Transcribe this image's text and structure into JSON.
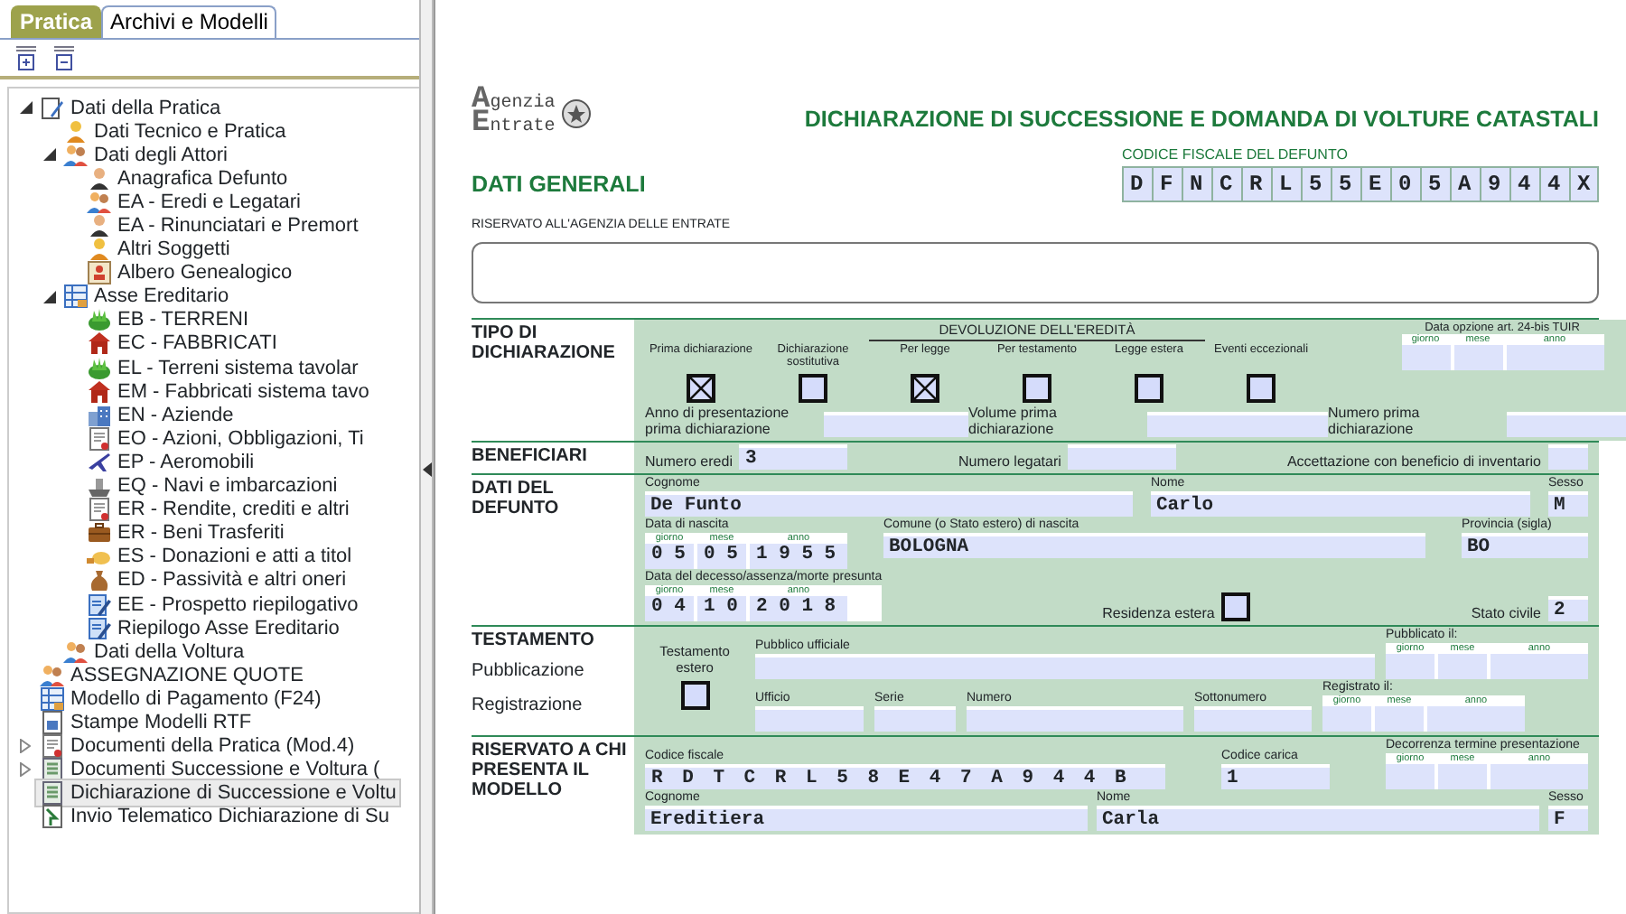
{
  "tabs": [
    {
      "label": "Pratica",
      "selected": true
    },
    {
      "label": "Archivi e Modelli",
      "selected": false
    }
  ],
  "tree": [
    {
      "label": "Dati della Pratica",
      "kind": "doc",
      "expanded": true,
      "selected": false,
      "children": [
        {
          "label": "Dati Tecnico e Pratica",
          "kind": "worker",
          "selected": false
        },
        {
          "label": "Dati degli Attori",
          "kind": "group",
          "expanded": true,
          "selected": false,
          "children": [
            {
              "label": "Anagrafica Defunto",
              "kind": "person",
              "selected": false
            },
            {
              "label": "EA - Eredi e Legatari",
              "kind": "group",
              "selected": false
            },
            {
              "label": "EA - Rinunciatari e Premort",
              "kind": "person",
              "selected": false
            },
            {
              "label": "Altri Soggetti",
              "kind": "worker",
              "selected": false
            },
            {
              "label": "Albero Genealogico",
              "kind": "chart",
              "selected": false
            }
          ]
        },
        {
          "label": "Asse Ereditario",
          "kind": "table",
          "expanded": true,
          "selected": false,
          "children": [
            {
              "label": "EB - TERRENI",
              "kind": "plant",
              "selected": false
            },
            {
              "label": "EC - FABBRICATI",
              "kind": "house",
              "selected": false
            },
            {
              "label": "EL - Terreni sistema tavolar",
              "kind": "plant",
              "selected": false
            },
            {
              "label": "EM - Fabbricati sistema tavo",
              "kind": "house",
              "selected": false
            },
            {
              "label": "EN - Aziende",
              "kind": "building",
              "selected": false
            },
            {
              "label": "EO - Azioni, Obbligazioni, Ti",
              "kind": "paper",
              "selected": false
            },
            {
              "label": "EP - Aeromobili",
              "kind": "plane",
              "selected": false
            },
            {
              "label": "EQ - Navi e imbarcazioni",
              "kind": "boat",
              "selected": false
            },
            {
              "label": "ER - Rendite, crediti e altri",
              "kind": "paper",
              "selected": false
            },
            {
              "label": "ER - Beni Trasferiti",
              "kind": "case",
              "selected": false
            },
            {
              "label": "ES - Donazioni e atti a titol",
              "kind": "hand",
              "selected": false
            },
            {
              "label": "ED - Passività e altri oneri",
              "kind": "bag",
              "selected": false
            },
            {
              "label": "EE - Prospetto riepilogativo",
              "kind": "edit",
              "selected": false
            },
            {
              "label": "Riepilogo Asse Ereditario",
              "kind": "edit",
              "selected": false
            }
          ]
        },
        {
          "label": "Dati della Voltura",
          "kind": "group",
          "selected": false
        }
      ]
    },
    {
      "label": "ASSEGNAZIONE QUOTE",
      "kind": "group",
      "selected": false
    },
    {
      "label": "Modello di Pagamento (F24)",
      "kind": "table",
      "selected": false
    },
    {
      "label": "Stampe Modelli RTF",
      "kind": "print",
      "selected": false
    },
    {
      "label": "Documenti della Pratica (Mod.4)",
      "kind": "paper",
      "expanded": false,
      "selected": false
    },
    {
      "label": "Documenti Successione e Voltura (",
      "kind": "sheet",
      "expanded": false,
      "selected": false
    },
    {
      "label": "Dichiarazione di Successione e Voltu",
      "kind": "sheet",
      "selected": true
    },
    {
      "label": "Invio Telematico Dichiarazione di Su",
      "kind": "send",
      "selected": false
    }
  ],
  "form": {
    "logo": [
      "Agenzia",
      "Entrate"
    ],
    "title": "DICHIARAZIONE DI SUCCESSIONE E DOMANDA DI VOLTURE CATASTALI",
    "codice_fiscale": {
      "label": "CODICE FISCALE DEL DEFUNTO",
      "value": "DFNCRL55E05A944X"
    },
    "heading": "DATI GENERALI",
    "reserved_label": "RISERVATO ALL'AGENZIA DELLE ENTRATE",
    "tipo": {
      "title": "TIPO DI DICHIARAZIONE",
      "group_label": "DEVOLUZIONE DELL'EREDITÀ",
      "checks": [
        {
          "label": "Prima dichiarazione",
          "checked": true
        },
        {
          "label": "Dichiarazione sostitutiva",
          "checked": false
        },
        {
          "label": "Per legge",
          "checked": true
        },
        {
          "label": "Per testamento",
          "checked": false
        },
        {
          "label": "Legge estera",
          "checked": false
        },
        {
          "label": "Eventi eccezionali",
          "checked": false
        }
      ],
      "option_date": {
        "label": "Data opzione art. 24-bis TUIR",
        "parts": [
          {
            "label": "giorno"
          },
          {
            "label": "mese"
          },
          {
            "label": "anno"
          }
        ]
      },
      "fields": [
        {
          "label": "Anno di presentazione prima dichiarazione"
        },
        {
          "label": "Volume prima dichiarazione"
        },
        {
          "label": "Numero prima dichiarazione"
        }
      ]
    },
    "beneficiari": {
      "title": "BENEFICIARI",
      "fields": [
        {
          "label": "Numero eredi",
          "value": "3"
        },
        {
          "label": "Numero legatari"
        },
        {
          "label": "Accettazione con beneficio di inventario"
        }
      ]
    },
    "defunto": {
      "title": "DATI DEL DEFUNTO",
      "cognome": {
        "label": "Cognome",
        "value": "De Funto"
      },
      "nome": {
        "label": "Nome",
        "value": "Carlo"
      },
      "sesso": {
        "label": "Sesso",
        "value": "M"
      },
      "nascita": {
        "label": "Data di nascita",
        "parts": [
          {
            "label": "giorno",
            "value": "05"
          },
          {
            "label": "mese",
            "value": "05"
          },
          {
            "label": "anno",
            "value": "1955"
          }
        ]
      },
      "comune": {
        "label": "Comune (o Stato estero) di nascita",
        "value": "BOLOGNA"
      },
      "provincia": {
        "label": "Provincia (sigla)",
        "value": "BO"
      },
      "decesso": {
        "label": "Data del decesso/assenza/morte presunta",
        "parts": [
          {
            "label": "giorno",
            "value": "04"
          },
          {
            "label": "mese",
            "value": "10"
          },
          {
            "label": "anno",
            "value": "2018"
          }
        ]
      },
      "residenza_estera": {
        "label": "Residenza estera",
        "checked": false
      },
      "stato_civile": {
        "label": "Stato civile",
        "value": "2"
      }
    },
    "testamento": {
      "title": "TESTAMENTO",
      "row_labels": [
        "Pubblicazione",
        "Registrazione"
      ],
      "estero": {
        "label": "Testamento estero",
        "checked": false
      },
      "pubblico_ufficiale": {
        "label": "Pubblico ufficiale"
      },
      "pubblicato": {
        "label": "Pubblicato il:",
        "parts": [
          {
            "label": "giorno"
          },
          {
            "label": "mese"
          },
          {
            "label": "anno"
          }
        ]
      },
      "ufficio": {
        "label": "Ufficio"
      },
      "serie": {
        "label": "Serie"
      },
      "numero": {
        "label": "Numero"
      },
      "sottonumero": {
        "label": "Sottonumero"
      },
      "registrato": {
        "label": "Registrato il:",
        "parts": [
          {
            "label": "giorno"
          },
          {
            "label": "mese"
          },
          {
            "label": "anno"
          }
        ]
      }
    },
    "presentatore": {
      "title": "RISERVATO A CHI PRESENTA IL MODELLO",
      "codice_fiscale": {
        "label": "Codice fiscale",
        "value": "RDTCRL58E47A944B"
      },
      "codice_carica": {
        "label": "Codice carica",
        "value": "1"
      },
      "decorrenza": {
        "label": "Decorrenza termine presentazione",
        "parts": [
          {
            "label": "giorno"
          },
          {
            "label": "mese"
          },
          {
            "label": "anno"
          }
        ]
      },
      "cognome": {
        "label": "Cognome",
        "value": "Ereditiera"
      },
      "nome": {
        "label": "Nome",
        "value": "Carla"
      },
      "sesso": {
        "label": "Sesso",
        "value": "F"
      }
    }
  }
}
